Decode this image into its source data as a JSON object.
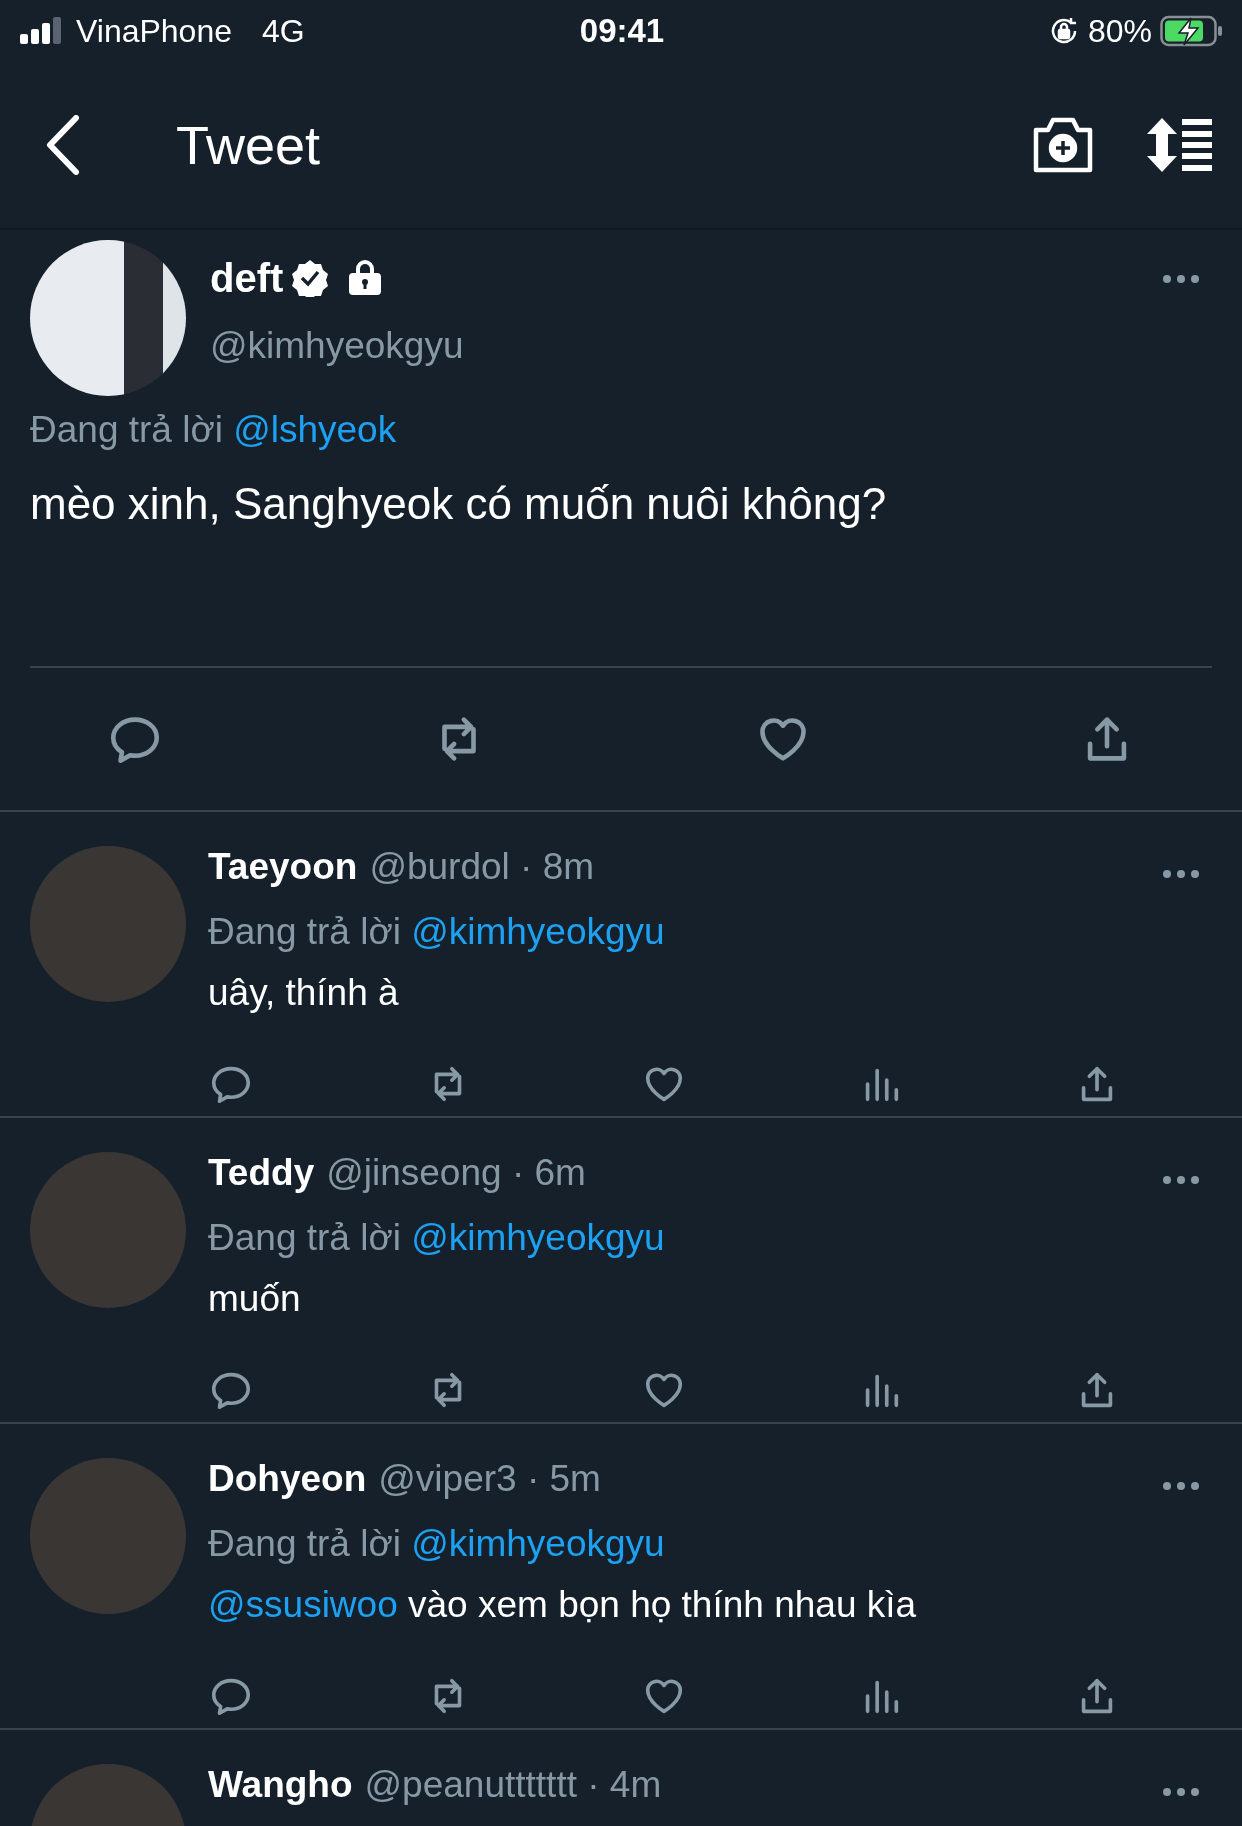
{
  "status_bar": {
    "carrier": "VinaPhone",
    "network": "4G",
    "time": "09:41",
    "battery": "80%",
    "charging": true
  },
  "header": {
    "title": "Tweet"
  },
  "main_tweet": {
    "name": "deft",
    "verified": true,
    "protected": true,
    "handle": "@kimhyeokgyu",
    "replying_label": "Đang trả lời",
    "replying_to": "@lshyeok",
    "text": "mèo xinh, Sanghyeok có muốn nuôi không?"
  },
  "replies": [
    {
      "name": "Taeyoon",
      "meta": "@burdol · 8m",
      "replying_label": "Đang trả lời",
      "replying_to": "@kimhyeokgyu",
      "text": "uây, thính à",
      "analytics": true
    },
    {
      "name": "Teddy",
      "meta": "@jinseong · 6m",
      "replying_label": "Đang trả lời",
      "replying_to": "@kimhyeokgyu",
      "text": "muốn",
      "analytics": true
    },
    {
      "name": "Dohyeon",
      "meta": "@viper3 · 5m",
      "replying_label": "Đang trả lời",
      "replying_to": "@kimhyeokgyu",
      "mention": "@ssusiwoo",
      "text": "vào xem bọn họ thính nhau kìa",
      "analytics": true
    },
    {
      "name": "Wangho",
      "meta": "@peanuttttttt · 4m"
    }
  ]
}
